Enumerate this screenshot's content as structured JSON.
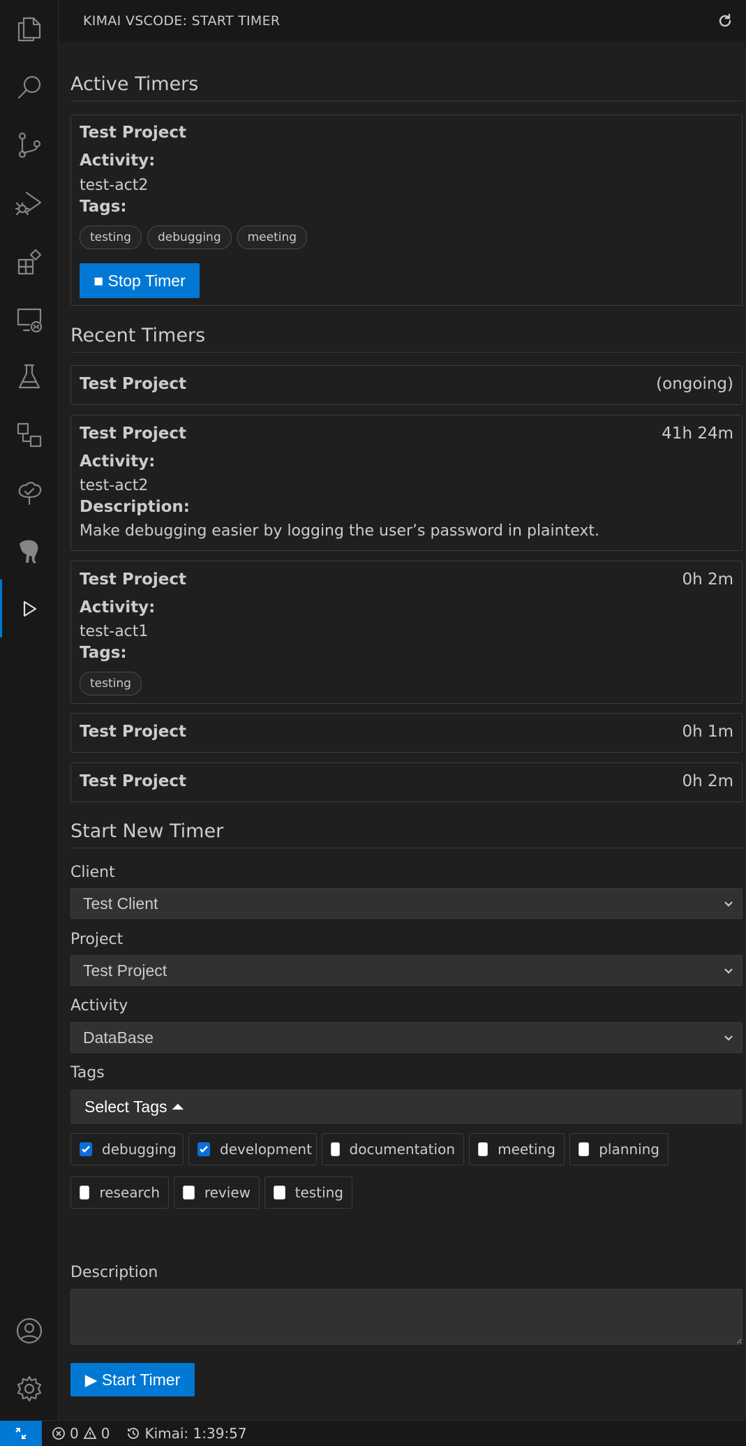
{
  "header": {
    "title": "KIMAI VSCODE: START TIMER",
    "refresh_icon": "refresh-icon"
  },
  "activity_bar": {
    "items": [
      "explorer-icon",
      "search-icon",
      "source-control-icon",
      "run-debug-icon",
      "extensions-icon",
      "remote-explorer-icon",
      "testing-icon",
      "containers-icon",
      "tree-check-icon",
      "elephant-icon",
      "kimai-play-icon"
    ],
    "bottom": [
      "account-icon",
      "settings-gear-icon"
    ]
  },
  "active": {
    "heading": "Active Timers",
    "timer": {
      "project": "Test Project",
      "activity_label": "Activity:",
      "activity": "test-act2",
      "tags_label": "Tags:",
      "tags": [
        "testing",
        "debugging",
        "meeting"
      ],
      "stop_label": "■ Stop Timer"
    }
  },
  "recent": {
    "heading": "Recent Timers",
    "items": [
      {
        "project": "Test Project",
        "duration": "(ongoing)"
      },
      {
        "project": "Test Project",
        "duration": "41h 24m",
        "activity_label": "Activity:",
        "activity": "test-act2",
        "description_label": "Description:",
        "description": "Make debugging easier by logging the user’s password in plaintext."
      },
      {
        "project": "Test Project",
        "duration": "0h 2m",
        "activity_label": "Activity:",
        "activity": "test-act1",
        "tags_label": "Tags:",
        "tags": [
          "testing"
        ]
      },
      {
        "project": "Test Project",
        "duration": "0h 1m"
      },
      {
        "project": "Test Project",
        "duration": "0h 2m"
      }
    ]
  },
  "new_timer": {
    "heading": "Start New Timer",
    "client_label": "Client",
    "client_value": "Test Client",
    "project_label": "Project",
    "project_value": "Test Project",
    "activity_label": "Activity",
    "activity_value": "DataBase",
    "tags_label": "Tags",
    "select_tags_label": "Select Tags ⏶",
    "tags": [
      {
        "name": "debugging",
        "checked": true
      },
      {
        "name": "development",
        "checked": true
      },
      {
        "name": "documentation",
        "checked": false
      },
      {
        "name": "meeting",
        "checked": false
      },
      {
        "name": "planning",
        "checked": false
      },
      {
        "name": "research",
        "checked": false
      },
      {
        "name": "review",
        "checked": false
      },
      {
        "name": "testing",
        "checked": false
      }
    ],
    "description_label": "Description",
    "description_value": "",
    "start_label": "▶ Start Timer"
  },
  "statusbar": {
    "errors": "0",
    "warnings": "0",
    "kimai": "Kimai: 1:39:57"
  },
  "colors": {
    "accent": "#0078d4",
    "background": "#1f1f1f",
    "panel": "#181818"
  }
}
